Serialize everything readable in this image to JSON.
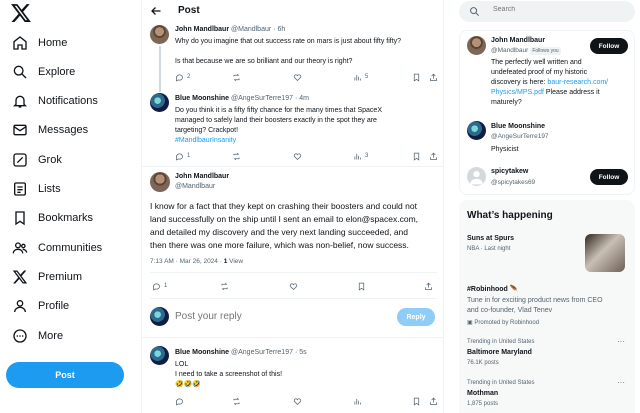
{
  "sidebar": {
    "logo": "X",
    "items": [
      {
        "label": "Home",
        "icon": "home-icon"
      },
      {
        "label": "Explore",
        "icon": "search-icon"
      },
      {
        "label": "Notifications",
        "icon": "bell-icon"
      },
      {
        "label": "Messages",
        "icon": "envelope-icon"
      },
      {
        "label": "Grok",
        "icon": "grok-icon"
      },
      {
        "label": "Lists",
        "icon": "list-icon"
      },
      {
        "label": "Bookmarks",
        "icon": "bookmark-icon"
      },
      {
        "label": "Communities",
        "icon": "people-icon"
      },
      {
        "label": "Premium",
        "icon": "x-logo-icon"
      },
      {
        "label": "Profile",
        "icon": "person-icon"
      },
      {
        "label": "More",
        "icon": "more-circle-icon"
      }
    ],
    "post_button": "Post"
  },
  "main": {
    "header_title": "Post",
    "tweet1": {
      "name": "John Mandlbaur",
      "handle": "@Mandlbaur",
      "time": "6h",
      "lines": [
        "Why do you imagine that out success rate on mars is just about fifty fifty?",
        "",
        "Is that because we are so brilliant and our theory is right?"
      ],
      "replies": "2",
      "views": "5"
    },
    "tweet2": {
      "name": "Blue Moonshine",
      "handle": "@AngeSurTerre197",
      "time": "4m",
      "lines": [
        "Do you think it is a fifty fifty chance for the many times that SpaceX",
        "managed to safely land their boosters exactly in the spot they are",
        "targeting? Crackpot!"
      ],
      "hashtag": "#MandlbaurInsanity",
      "replies": "1",
      "views": "3"
    },
    "focus": {
      "name": "John Mandlbaur",
      "handle": "@Mandlbaur",
      "lines": [
        "I know for a fact that they kept on crashing their boosters and could not",
        "land successfully on the ship until I sent an email to elon@spacex.com,",
        "and detailed my discovery and the very next landing succeeded, and",
        "then there was one more failure, which was non-belief, now success."
      ],
      "time_date": "7:13 AM · Mar 26, 2024 · ",
      "view_count": "1",
      "view_label": "View",
      "replies": "1"
    },
    "reply_box": {
      "placeholder": "Post your reply",
      "button": "Reply"
    },
    "tweet4": {
      "name": "Blue Moonshine",
      "handle": "@AngeSurTerre197",
      "time": "5s",
      "lines": [
        "LOL",
        "I need to take a screenshot of this!",
        "🤣🤣🤣"
      ]
    }
  },
  "right": {
    "search_placeholder": "Search",
    "who_to_follow": [
      {
        "name": "John Mandlbaur",
        "handle": "@Mandlbaur",
        "follows_you": "Follows you",
        "bio_lines": [
          "The perfectly well written and",
          "undefeated proof of my historic",
          "discovery is here: "
        ],
        "bio_link": "baur-research.com/",
        "bio_link2": "Physics/MPS.pdf",
        "bio_tail": " Please address it",
        "bio_last": "maturely?",
        "button": "Follow"
      },
      {
        "name": "Blue Moonshine",
        "handle": "@AngeSurTerre197",
        "bio": "Physicist"
      },
      {
        "name": "spicytakew",
        "handle": "@spicytakes69",
        "button": "Follow"
      }
    ],
    "happening": {
      "title": "What’s happening",
      "items": [
        {
          "head": "Suns at Spurs",
          "sub": "NBA · Last night"
        },
        {
          "head": "#Robinhood 🪶",
          "lines": [
            "Tune in for exciting product news from CEO",
            "and co-founder, Vlad Tenev"
          ],
          "promoted": "Promoted by Robinhood"
        },
        {
          "context": "Trending in United States",
          "head": "Baltimore Maryland",
          "sub": "76.1K posts"
        },
        {
          "context": "Trending in United States",
          "head": "Mothman",
          "sub": "1,875 posts"
        }
      ]
    }
  },
  "colors": {
    "accent": "#1d9bf0",
    "text": "#0f1419",
    "muted": "#536471",
    "border": "#eff3f4"
  }
}
